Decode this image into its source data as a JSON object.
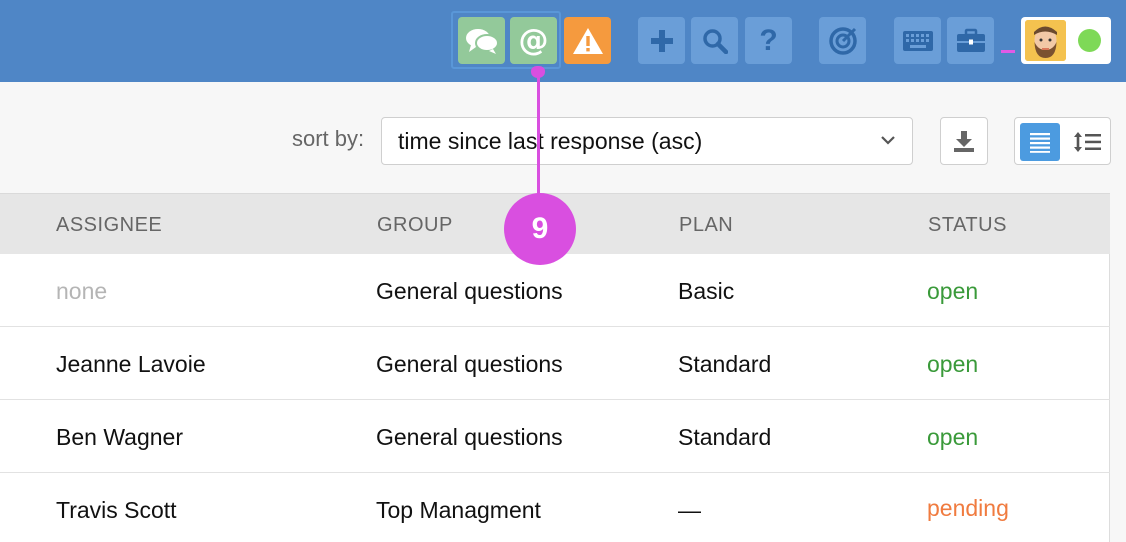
{
  "toolbar": {
    "buttons": [
      {
        "name": "chat-icon",
        "color": "#93c99a"
      },
      {
        "name": "at-mention-icon",
        "color": "#93c99a"
      },
      {
        "name": "warning-icon",
        "color": "#f59a3e"
      },
      {
        "name": "plus-icon",
        "color": "#6a9ed8"
      },
      {
        "name": "search-icon",
        "color": "#6a9ed8"
      },
      {
        "name": "help-icon",
        "color": "#6a9ed8"
      },
      {
        "name": "target-icon",
        "color": "#6a9ed8"
      },
      {
        "name": "keyboard-icon",
        "color": "#6a9ed8"
      },
      {
        "name": "briefcase-icon",
        "color": "#6a9ed8"
      }
    ],
    "user_status": "online"
  },
  "sort": {
    "label": "sort by:",
    "value": "time since last response (asc)"
  },
  "table": {
    "columns": [
      "ASSIGNEE",
      "GROUP",
      "PLAN",
      "STATUS"
    ],
    "rows": [
      {
        "assignee": "none",
        "group": "General questions",
        "plan": "Basic",
        "status": "open"
      },
      {
        "assignee": "Jeanne Lavoie",
        "group": "General questions",
        "plan": "Standard",
        "status": "open"
      },
      {
        "assignee": "Ben Wagner",
        "group": "General questions",
        "plan": "Standard",
        "status": "open"
      },
      {
        "assignee": "Travis Scott",
        "group": "Top Managment",
        "plan": "—",
        "status": "pending"
      }
    ]
  },
  "callout": {
    "number": "9"
  },
  "colors": {
    "topbar": "#4f86c6",
    "accent_pink": "#d94fe0",
    "status_open": "#3a9a3a",
    "status_pending": "#f07b3f"
  }
}
